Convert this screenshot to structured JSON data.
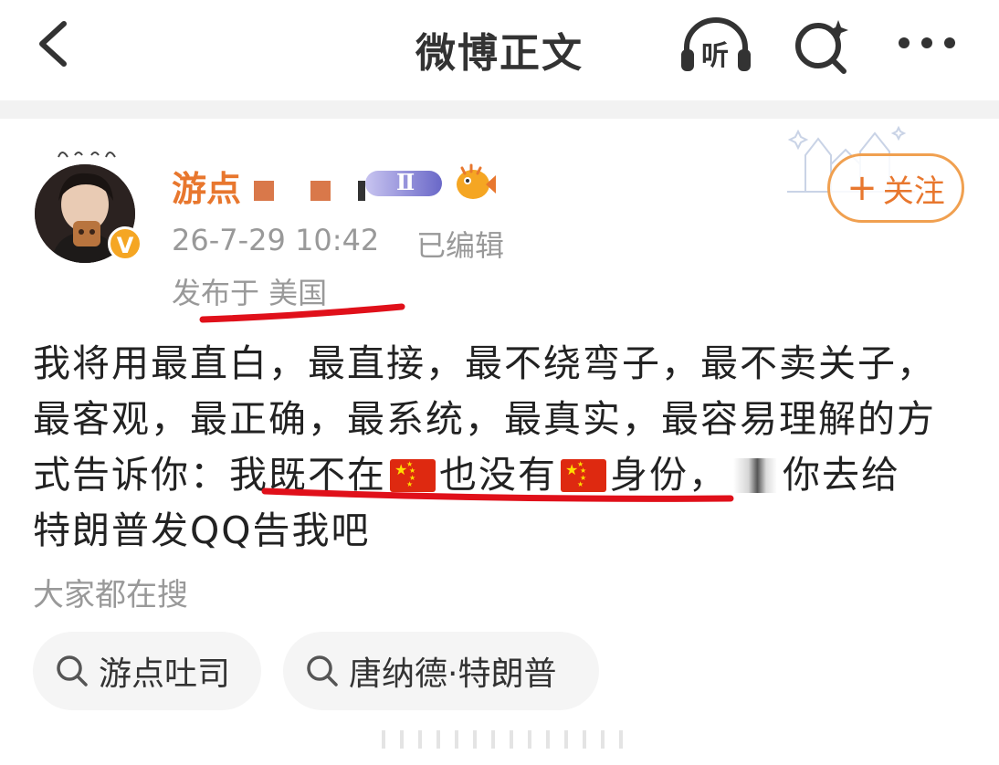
{
  "header": {
    "title": "微博正文",
    "listen_label": "听"
  },
  "post": {
    "author": {
      "name_visible": "游点",
      "badge_text": "Ⅱ",
      "verified_mark": "V"
    },
    "follow_button": "关注",
    "timestamp": "26-7-29 10:42",
    "edited": "已编辑",
    "location": "发布于 美国",
    "body": {
      "line1": "我将用最直白，最直接，最不绕弯子，最不卖关子，",
      "line2": "最客观，最正确，最系统，最真实，最容易理解的方",
      "line3_prefix": "式告诉你：我既不在",
      "line3_mid": "也没有",
      "line3_after": "身份，",
      "line3_tail": "你去给",
      "line4": "特朗普发QQ告我吧"
    }
  },
  "trending": {
    "label": "大家都在搜",
    "chips": [
      "游点吐司",
      "唐纳德·特朗普"
    ]
  },
  "colors": {
    "accent": "#e8772e",
    "annotation_red": "#e0101a",
    "muted": "#999999"
  },
  "icons": [
    "back-arrow-icon",
    "headphone-listen-icon",
    "search-sparkle-icon",
    "more-dots-icon",
    "search-icon",
    "china-flag-icon",
    "fish-icon"
  ]
}
